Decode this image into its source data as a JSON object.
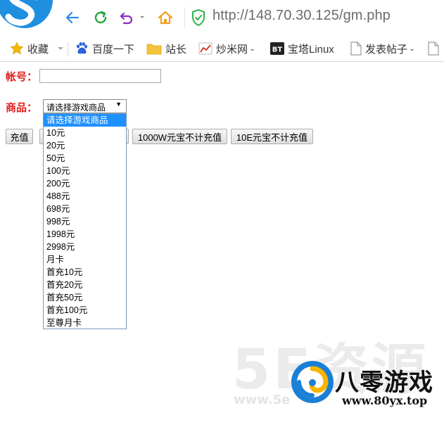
{
  "browser": {
    "url": "http://148.70.30.125/gm.php",
    "accent_color": "#1f8fe0",
    "bookmarks": [
      {
        "label": "收藏",
        "icon": "star-icon"
      },
      {
        "label": "百度一下",
        "icon": "baidu-paw-icon"
      },
      {
        "label": "站长",
        "icon": "folder-icon"
      },
      {
        "label": "炒米网 -",
        "icon": "chart-icon"
      },
      {
        "label": "宝塔Linux",
        "icon": "bt-icon"
      },
      {
        "label": "发表帖子 -",
        "icon": "document-icon"
      }
    ]
  },
  "form": {
    "account_label": "帐号：",
    "account_value": "",
    "product_label": "商品：",
    "product_selected": "请选择游戏商品",
    "options": [
      "请选择游戏商品",
      "10元",
      "20元",
      "50元",
      "100元",
      "200元",
      "488元",
      "698元",
      "998元",
      "1998元",
      "2998元",
      "月卡",
      "首充10元",
      "首充20元",
      "首充50元",
      "首充100元",
      "至尊月卡"
    ],
    "buttons": {
      "recharge": "充值",
      "yuanbao_1000w": "1000W元宝不计充值",
      "yuanbao_10e": "10E元宝不计充值"
    }
  },
  "watermark": {
    "brand_name": "八零游戏",
    "brand_url": "www.80yx.top",
    "faded_text": "5E资源",
    "faded_url": "www.5e"
  }
}
